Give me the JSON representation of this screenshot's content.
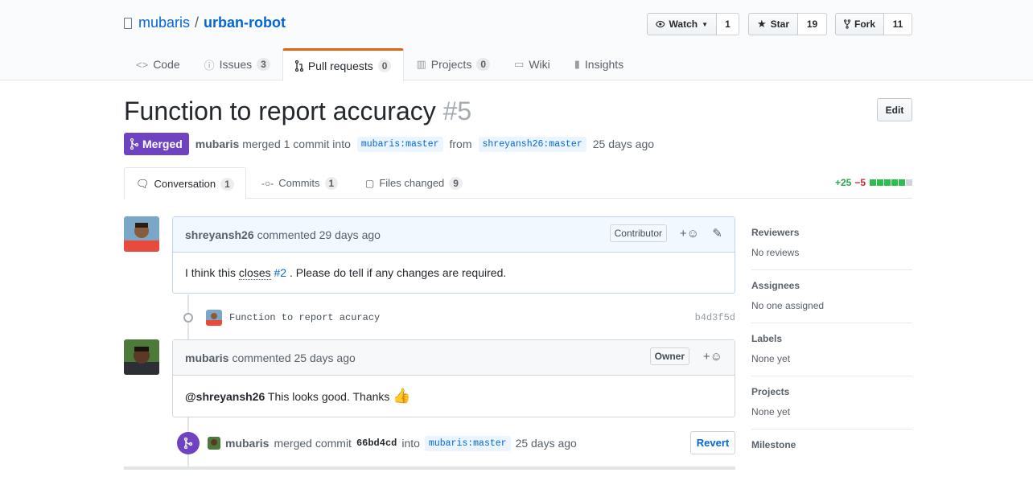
{
  "repo": {
    "owner": "mubaris",
    "separator": "/",
    "name": "urban-robot"
  },
  "actions": {
    "watch": {
      "label": "Watch",
      "count": "1"
    },
    "star": {
      "label": "Star",
      "count": "19"
    },
    "fork": {
      "label": "Fork",
      "count": "11"
    }
  },
  "nav": {
    "code": "Code",
    "issues": {
      "label": "Issues",
      "count": "3"
    },
    "pulls": {
      "label": "Pull requests",
      "count": "0"
    },
    "projects": {
      "label": "Projects",
      "count": "0"
    },
    "wiki": "Wiki",
    "insights": "Insights"
  },
  "pr": {
    "title": "Function to report accuracy",
    "number": "#5",
    "edit_label": "Edit",
    "state": "Merged",
    "author": "mubaris",
    "merged_text": "merged 1 commit into",
    "base": "mubaris:master",
    "from": "from",
    "head": "shreyansh26:master",
    "time": "25 days ago"
  },
  "tabs": {
    "conversation": {
      "label": "Conversation",
      "count": "1"
    },
    "commits": {
      "label": "Commits",
      "count": "1"
    },
    "files": {
      "label": "Files changed",
      "count": "9"
    }
  },
  "diffstat": {
    "additions": "+25",
    "deletions": "−5"
  },
  "comments": [
    {
      "author": "shreyansh26",
      "action": "commented 29 days ago",
      "role": "Contributor",
      "body_pre": "I think this",
      "body_closes": "closes",
      "body_issue": "#2",
      "body_post": ". Please do tell if any changes are required."
    },
    {
      "author": "mubaris",
      "action": "commented 25 days ago",
      "role": "Owner",
      "body_mention": "@shreyansh26",
      "body_text": "This looks good. Thanks",
      "emoji": "👍"
    }
  ],
  "commit": {
    "message": "Function to report acuracy",
    "sha": "b4d3f5d"
  },
  "merge": {
    "author": "mubaris",
    "text": "merged commit",
    "sha": "66bd4cd",
    "into": "into",
    "base": "mubaris:master",
    "time": "25 days ago",
    "revert_label": "Revert"
  },
  "sidebar": {
    "reviewers": {
      "heading": "Reviewers",
      "value": "No reviews"
    },
    "assignees": {
      "heading": "Assignees",
      "value": "No one assigned"
    },
    "labels": {
      "heading": "Labels",
      "value": "None yet"
    },
    "projects": {
      "heading": "Projects",
      "value": "None yet"
    },
    "milestone": {
      "heading": "Milestone"
    }
  },
  "colors": {
    "merged": "#6f42c1",
    "link": "#0366d6",
    "tab_accent": "#e36209",
    "additions": "#28a745",
    "deletions": "#cb2431"
  }
}
